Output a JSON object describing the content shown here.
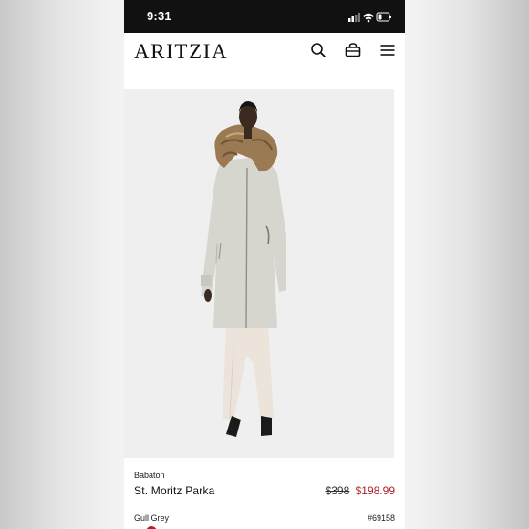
{
  "status_bar": {
    "time": "9:31"
  },
  "header": {
    "logo": "ARITZIA",
    "icons": [
      "search-icon",
      "bag-icon",
      "menu-icon"
    ]
  },
  "product": {
    "brand": "Babaton",
    "name": "St. Moritz Parka",
    "original_price": "$398",
    "sale_price": "$198.99",
    "color": "Gull Grey",
    "sku": "#69158"
  },
  "colors": {
    "sale": "#b3202a",
    "status_bar": "#111111",
    "text": "#111111"
  }
}
